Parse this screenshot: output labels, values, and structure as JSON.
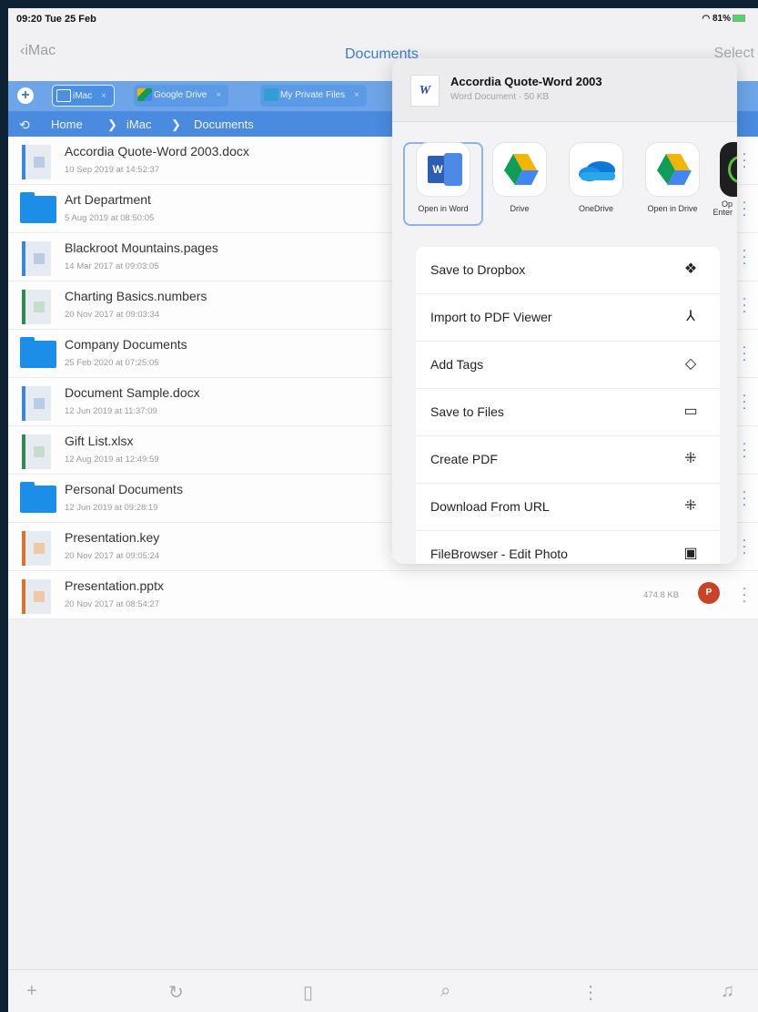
{
  "status": {
    "time": "09:20  Tue 25 Feb",
    "battery": "81%"
  },
  "nav": {
    "back": "iMac",
    "title": "Documents",
    "select": "Select"
  },
  "tabs": [
    {
      "label": "iMac",
      "close": "×"
    },
    {
      "label": "Google Drive",
      "close": "×"
    },
    {
      "label": "My Private Files",
      "close": "×"
    }
  ],
  "breadcrumb": {
    "home": "Home",
    "imac": "iMac",
    "docs": "Documents"
  },
  "files": [
    {
      "name": "Accordia Quote-Word 2003.docx",
      "date": "10 Sep 2019 at 14:52:37",
      "kind": "doc"
    },
    {
      "name": "Art Department",
      "date": "5 Aug 2019 at 08:50:05",
      "kind": "folder"
    },
    {
      "name": "Blackroot Mountains.pages",
      "date": "14 Mar 2017 at 09:03:05",
      "kind": "doc"
    },
    {
      "name": "Charting Basics.numbers",
      "date": "20 Nov 2017 at 09:03:34",
      "kind": "sheet"
    },
    {
      "name": "Company Documents",
      "date": "25 Feb 2020 at 07:25:05",
      "kind": "folder"
    },
    {
      "name": "Document Sample.docx",
      "date": "12 Jun 2019 at 11:37:09",
      "kind": "doc"
    },
    {
      "name": "Gift List.xlsx",
      "date": "12 Aug 2019 at 12:49:59",
      "kind": "sheet"
    },
    {
      "name": "Personal Documents",
      "date": "12 Jun 2019 at 09:28:19",
      "kind": "folder"
    },
    {
      "name": "Presentation.key",
      "date": "20 Nov 2017 at 09:05:24",
      "kind": "slides"
    },
    {
      "name": "Presentation.pptx",
      "date": "20 Nov 2017 at 08:54:27",
      "kind": "slides",
      "size": "474.8 KB"
    }
  ],
  "share": {
    "title": "Accordia Quote-Word 2003",
    "subtitle": "Word Document · 50 KB",
    "apps": [
      "Open in Word",
      "Drive",
      "OneDrive",
      "Open in Drive",
      "Op\nEnter"
    ],
    "actions": [
      {
        "label": "Save to Dropbox",
        "icon": "dropbox-icon"
      },
      {
        "label": "Import to PDF Viewer",
        "icon": "acrobat-icon"
      },
      {
        "label": "Add Tags",
        "icon": "tag-icon"
      },
      {
        "label": "Save to Files",
        "icon": "folder-icon"
      },
      {
        "label": "Create PDF",
        "icon": "sparkle-icon"
      },
      {
        "label": "Download From URL",
        "icon": "sparkle-icon"
      },
      {
        "label": "FileBrowser - Edit Photo",
        "icon": "photo-icon"
      }
    ]
  },
  "toolbar": [
    "plus-icon",
    "refresh-icon",
    "bookmark-icon",
    "search-icon",
    "sort-icon",
    "music-icon"
  ],
  "colors": {
    "accent": "#3a7bd5",
    "tabbar": "#6da5e8",
    "breadcrumb": "#4a8be0",
    "folder": "#1c8ee8"
  }
}
